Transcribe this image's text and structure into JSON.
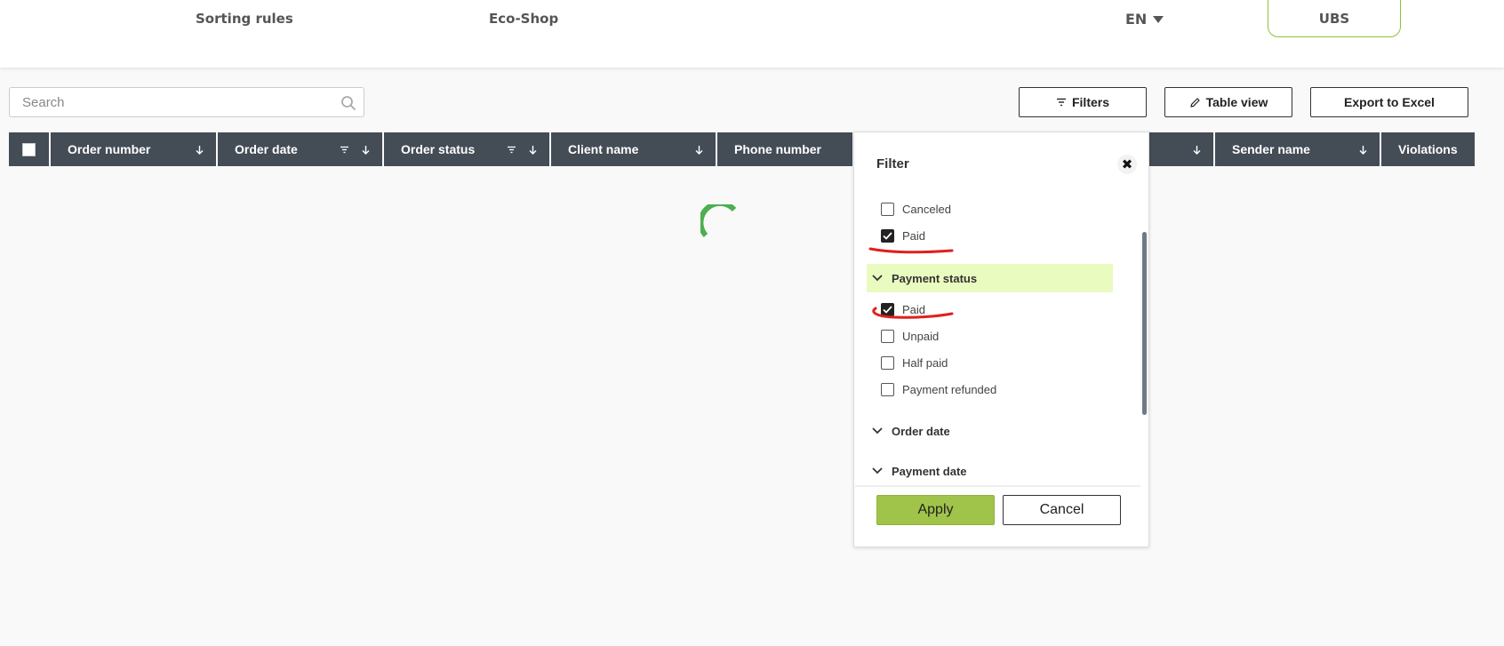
{
  "nav": {
    "sorting_rules": "Sorting rules",
    "eco_shop": "Eco-Shop",
    "language": "EN",
    "ubs": "UBS"
  },
  "search": {
    "placeholder": "Search",
    "icon": "search-icon"
  },
  "toolbar": {
    "filters": "Filters",
    "table_view": "Table view",
    "export": "Export to Excel"
  },
  "table": {
    "columns": [
      {
        "label": "Order number"
      },
      {
        "label": "Order date"
      },
      {
        "label": "Order status"
      },
      {
        "label": "Client name"
      },
      {
        "label": "Phone number"
      },
      {
        "label": ""
      },
      {
        "label": "Sender name"
      },
      {
        "label": "Violations"
      }
    ]
  },
  "filter_panel": {
    "title": "Filter",
    "order_status_options": [
      {
        "label": "Canceled",
        "checked": false
      },
      {
        "label": "Paid",
        "checked": true
      }
    ],
    "payment_status": {
      "title": "Payment status",
      "options": [
        {
          "label": "Paid",
          "checked": true
        },
        {
          "label": "Unpaid",
          "checked": false
        },
        {
          "label": "Half paid",
          "checked": false
        },
        {
          "label": "Payment refunded",
          "checked": false
        }
      ]
    },
    "sections": {
      "order_date": "Order date",
      "payment_date": "Payment date"
    },
    "apply": "Apply",
    "cancel": "Cancel"
  },
  "colors": {
    "header_bg": "#444c56",
    "accent_green": "#a0c44a",
    "highlight": "#eafbc0",
    "spinner": "#4caf50",
    "annotation_red": "#e0201c"
  }
}
